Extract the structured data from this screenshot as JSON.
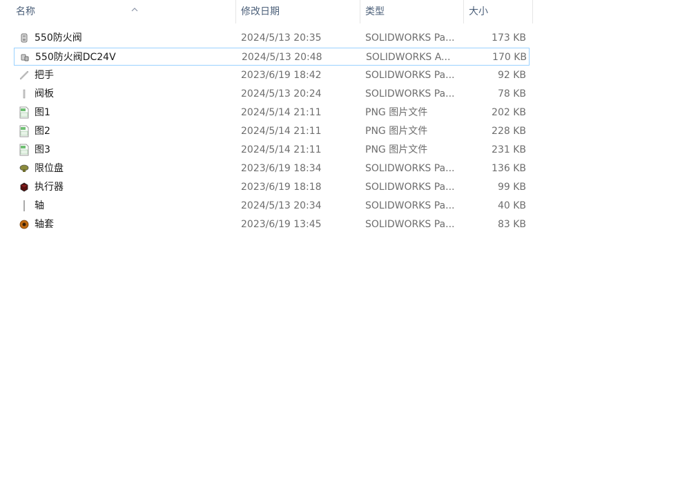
{
  "columns": {
    "name": "名称",
    "date": "修改日期",
    "type": "类型",
    "size": "大小"
  },
  "sort": {
    "column": "name",
    "direction": "ascending",
    "icon": "chevron-up-icon"
  },
  "files": [
    {
      "name": "550防火阀",
      "date": "2024/5/13 20:35",
      "type": "SOLIDWORKS Pa...",
      "size": "173 KB",
      "icon": "solidworks-part-icon",
      "selected": false
    },
    {
      "name": "550防火阀DC24V",
      "date": "2024/5/13 20:48",
      "type": "SOLIDWORKS A...",
      "size": "170 KB",
      "icon": "solidworks-assembly-icon",
      "selected": true
    },
    {
      "name": "把手",
      "date": "2023/6/19 18:42",
      "type": "SOLIDWORKS Pa...",
      "size": "92 KB",
      "icon": "handle-part-icon",
      "selected": false
    },
    {
      "name": "阀板",
      "date": "2024/5/13 20:24",
      "type": "SOLIDWORKS Pa...",
      "size": "78 KB",
      "icon": "plate-part-icon",
      "selected": false
    },
    {
      "name": "图1",
      "date": "2024/5/14 21:11",
      "type": "PNG 图片文件",
      "size": "202 KB",
      "icon": "png-image-icon",
      "selected": false
    },
    {
      "name": "图2",
      "date": "2024/5/14 21:11",
      "type": "PNG 图片文件",
      "size": "228 KB",
      "icon": "png-image-icon",
      "selected": false
    },
    {
      "name": "图3",
      "date": "2024/5/14 21:11",
      "type": "PNG 图片文件",
      "size": "231 KB",
      "icon": "png-image-icon",
      "selected": false
    },
    {
      "name": "限位盘",
      "date": "2023/6/19 18:34",
      "type": "SOLIDWORKS Pa...",
      "size": "136 KB",
      "icon": "limit-disc-part-icon",
      "selected": false
    },
    {
      "name": "执行器",
      "date": "2023/6/19 18:18",
      "type": "SOLIDWORKS Pa...",
      "size": "99 KB",
      "icon": "actuator-part-icon",
      "selected": false
    },
    {
      "name": "轴",
      "date": "2024/5/13 20:34",
      "type": "SOLIDWORKS Pa...",
      "size": "40 KB",
      "icon": "shaft-part-icon",
      "selected": false
    },
    {
      "name": "轴套",
      "date": "2023/6/19 13:45",
      "type": "SOLIDWORKS Pa...",
      "size": "83 KB",
      "icon": "bushing-part-icon",
      "selected": false
    }
  ],
  "colors": {
    "header_text": "#4c607a",
    "selection_border": "#99d1ff",
    "secondary_text": "#6d6d6d"
  }
}
